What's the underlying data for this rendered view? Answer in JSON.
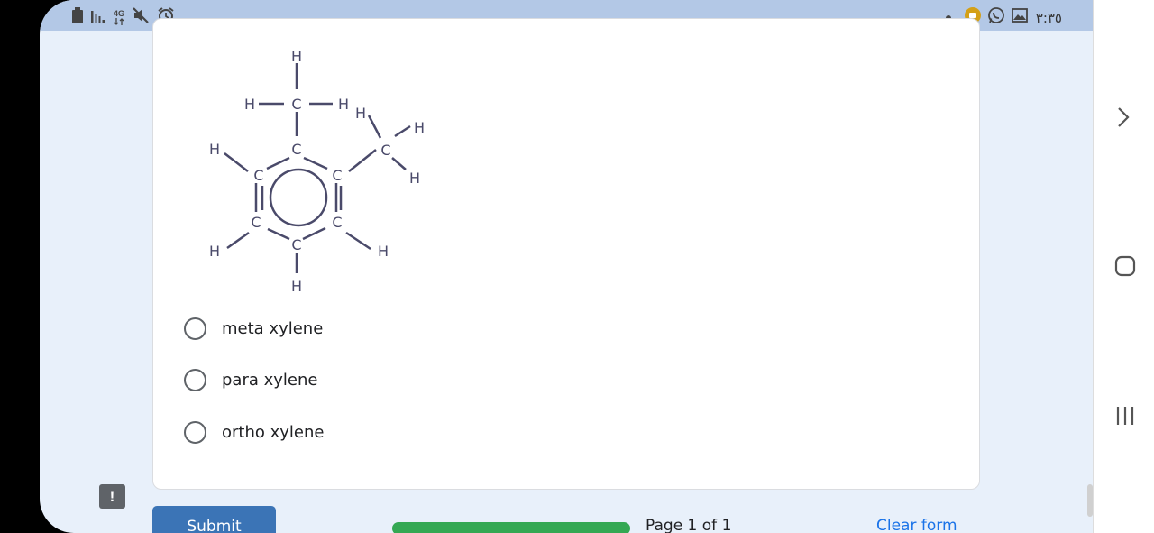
{
  "status_bar": {
    "left_icons": [
      "battery-icon",
      "signal-icon",
      "network-4g-icon",
      "mute-icon",
      "alarm-icon"
    ],
    "network_label": "4G",
    "right_icons": [
      "dot-icon",
      "notification-app-icon",
      "whatsapp-icon",
      "gallery-icon"
    ],
    "time": "٣:٣٥"
  },
  "question": {
    "image": {
      "atoms": {
        "top_h": "H",
        "methyl_h_left": "H",
        "methyl_c": "C",
        "methyl_h_right": "H",
        "ring_c_top": "C",
        "ring_c_upper_left": "C",
        "ring_c_upper_right": "C",
        "ring_c_lower_left": "C",
        "ring_c_lower_right": "C",
        "ring_c_bottom": "C",
        "second_c": "C",
        "second_h_upper_left": "H",
        "second_h_right": "H",
        "second_h_lower": "H",
        "ring_h_upper_left": "H",
        "ring_h_lower_left": "H",
        "ring_h_lower_right": "H",
        "ring_h_bottom": "H"
      }
    },
    "options": [
      {
        "label": "meta xylene"
      },
      {
        "label": "para xylene"
      },
      {
        "label": "ortho xylene"
      }
    ]
  },
  "footer": {
    "submit_label": "Submit",
    "page_text": "Page 1 of 1",
    "clear_label": "Clear form",
    "progress_fraction": 1.0
  },
  "report_icon_glyph": "!",
  "nav": {
    "items": [
      "forward-chevron-icon",
      "home-icon",
      "recent-apps-icon"
    ]
  }
}
